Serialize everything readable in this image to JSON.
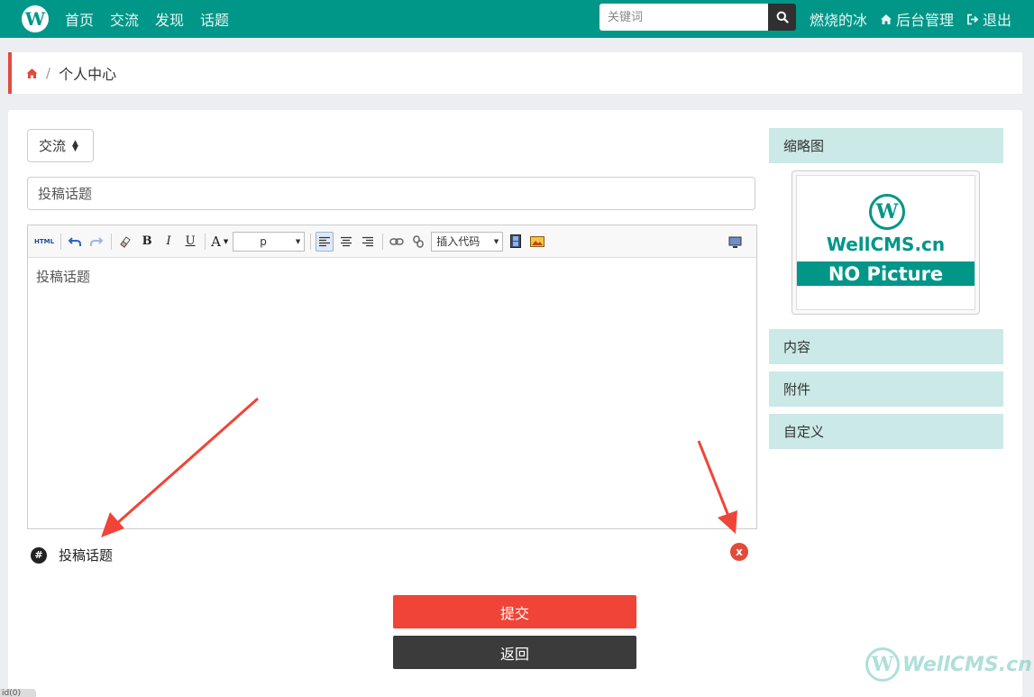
{
  "nav": {
    "logo_letter": "W",
    "links": [
      "首页",
      "交流",
      "发现",
      "话题"
    ],
    "search_placeholder": "关键词",
    "user": "燃烧的冰",
    "admin": "后台管理",
    "logout": "退出"
  },
  "breadcrumb": {
    "separator": "/",
    "current": "个人中心"
  },
  "form": {
    "forum_select": "交流",
    "title_value": "投稿话题",
    "toolbar": {
      "html": "HTML",
      "bold": "B",
      "italic": "I",
      "underline": "U",
      "font_color": "A",
      "paragraph_select": "p",
      "insert_code": "插入代码"
    },
    "body_text": "投稿话题",
    "tag_hash": "#",
    "tag_label": "投稿话题",
    "tag_remove": "x",
    "submit": "提交",
    "back": "返回"
  },
  "side": {
    "thumbnail_title": "缩略图",
    "thumb_logo": "W",
    "thumb_brand": "WellCMS.cn",
    "thumb_bar": "NO Picture",
    "sections": [
      "内容",
      "附件",
      "自定义"
    ]
  },
  "watermark": {
    "logo": "W",
    "text": "WellCMS.cn"
  },
  "status_hint": "id(0)",
  "colors": {
    "nav_bg": "#009688",
    "breadcrumb_accent": "#e14b3b",
    "submit": "#f04438",
    "back": "#3b3b3b",
    "side_header": "#cbe9e6",
    "arrow": "#f04438"
  }
}
